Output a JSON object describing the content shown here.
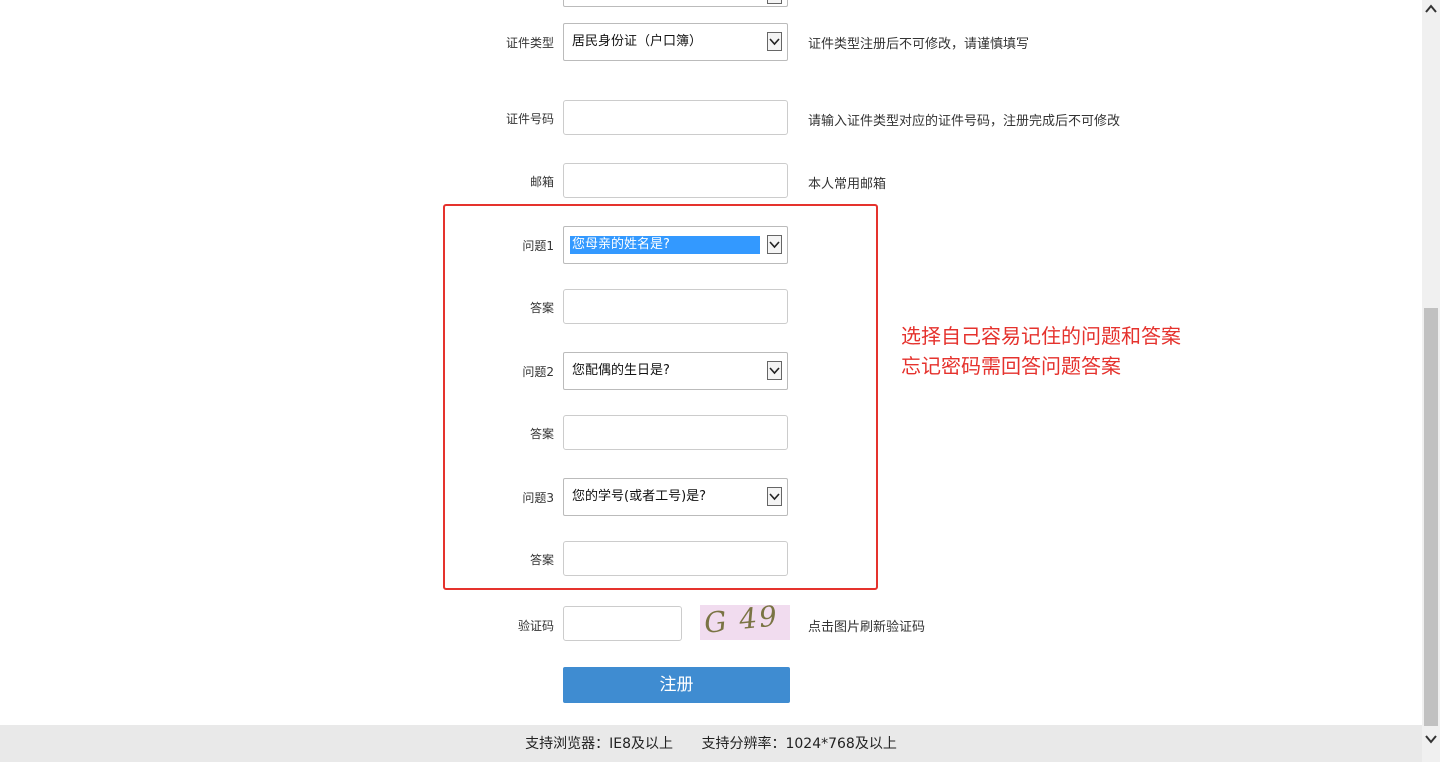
{
  "form": {
    "id_type": {
      "label": "证件类型",
      "value": "居民身份证（户口簿）",
      "hint": "证件类型注册后不可修改，请谨慎填写"
    },
    "id_number": {
      "label": "证件号码",
      "value": "",
      "hint": "请输入证件类型对应的证件号码，注册完成后不可修改"
    },
    "email": {
      "label": "邮箱",
      "value": "",
      "hint": "本人常用邮箱"
    },
    "q1": {
      "label": "问题1",
      "value": "您母亲的姓名是?"
    },
    "a1": {
      "label": "答案",
      "value": ""
    },
    "q2": {
      "label": "问题2",
      "value": "您配偶的生日是?"
    },
    "a2": {
      "label": "答案",
      "value": ""
    },
    "q3": {
      "label": "问题3",
      "value": "您的学号(或者工号)是?"
    },
    "a3": {
      "label": "答案",
      "value": ""
    },
    "captcha": {
      "label": "验证码",
      "value": "",
      "image_text": "G 49",
      "hint": "点击图片刷新验证码"
    },
    "submit_label": "注册"
  },
  "annotation": {
    "line1": "选择自己容易记住的问题和答案",
    "line2": "忘记密码需回答问题答案",
    "color": "#e5322d"
  },
  "footer": {
    "browser": "支持浏览器：IE8及以上",
    "resolution": "支持分辨率：1024*768及以上"
  },
  "colors": {
    "accent": "#3f8cd1",
    "selection": "#3399ff"
  }
}
